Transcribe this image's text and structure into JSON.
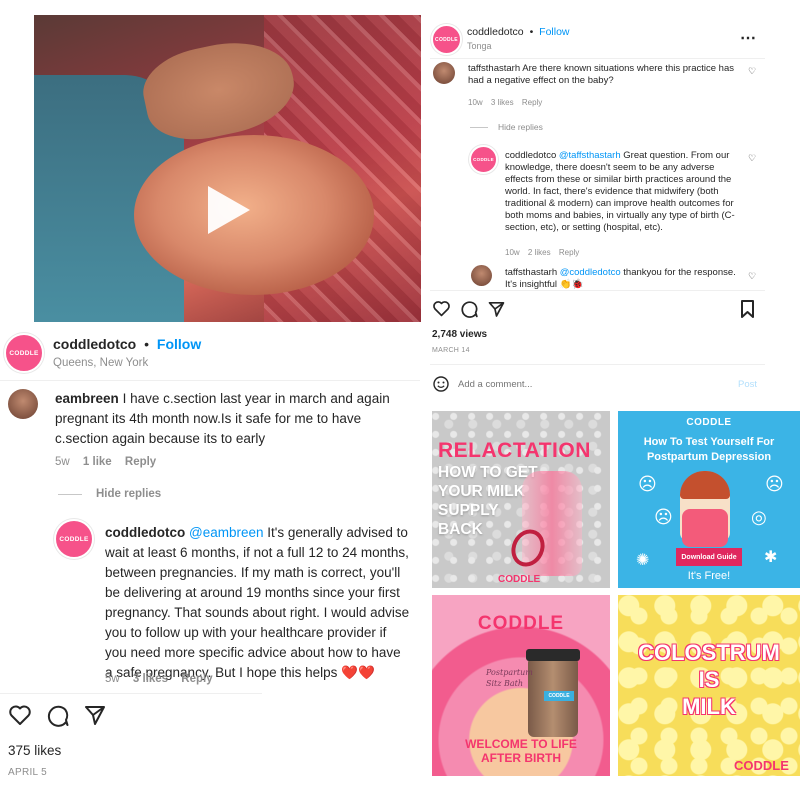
{
  "left_post": {
    "username": "coddledotco",
    "separator": "•",
    "follow_label": "Follow",
    "location": "Queens, New York",
    "avatar_text": "CODDLE",
    "comment": {
      "username": "eambreen",
      "text": "I have c.section last year in march and again pregnant its 4th month now.Is it safe for me to have c.section again because its to early",
      "age": "5w",
      "likes": "1 like",
      "reply_label": "Reply"
    },
    "hide_replies_label": "Hide replies",
    "reply": {
      "username": "coddledotco",
      "mention": "@eambreen",
      "text": "It's generally advised to wait at least 6 months, if not a full 12 to 24 months, between pregnancies. If my math is correct, you'll be delivering at around 19 months since your first pregnancy. That sounds about right. I would advise you to follow up with your healthcare provider if you need more specific advice about how to have a safe pregnancy. But I hope this helps",
      "emoji": "❤️❤️",
      "age": "5w",
      "likes": "3 likes",
      "reply_label": "Reply"
    },
    "like_count": "375 likes",
    "date": "APRIL 5"
  },
  "right_post": {
    "username": "coddledotco",
    "separator": "•",
    "follow_label": "Follow",
    "location": "Tonga",
    "avatar_text": "CODDLE",
    "more_icon": "⋯",
    "comment1": {
      "username": "taffsthastarh",
      "text": "Are there known situations where this practice has had a negative effect on the baby?",
      "age": "10w",
      "likes": "3 likes",
      "reply_label": "Reply"
    },
    "hide_replies_label": "Hide replies",
    "reply1": {
      "username": "coddledotco",
      "mention": "@taffsthastarh",
      "text": "Great question. From our knowledge, there doesn't seem to be any adverse effects from these or similar birth practices around the world. In fact, there's evidence that midwifery (both traditional & modern) can improve health outcomes for both moms and babies, in virtually any type of birth (C-section, etc), or setting (hospital, etc).",
      "age": "10w",
      "likes": "2 likes",
      "reply_label": "Reply"
    },
    "reply2": {
      "username": "taffsthastarh",
      "mention": "@coddledotco",
      "text": "thankyou for the response. It's insightful",
      "emoji": "👏🐞"
    },
    "views": "2,748 views",
    "date": "MARCH 14",
    "add_comment_placeholder": "Add a comment...",
    "post_label": "Post"
  },
  "tiles": {
    "t1": {
      "line1": "RELACTATION",
      "line2": "HOW TO GET",
      "line3": "YOUR MILK",
      "line4": "SUPPLY",
      "line5": "BACK",
      "brand": "CODDLE"
    },
    "t2": {
      "brand": "CODDLE",
      "title1": "How To Test Yourself For",
      "title2": "Postpartum Depression",
      "button": "Download Guide",
      "footer": "It's Free!"
    },
    "t3": {
      "brand": "CODDLE",
      "jar_line1": "Postpartum",
      "jar_line2": "Sitz Bath",
      "jar_label": "CODDLE",
      "footer1": "WELCOME TO LIFE",
      "footer2": "AFTER BIRTH"
    },
    "t4": {
      "line1": "COLOSTRUM",
      "line2": "IS",
      "line3": "MILK",
      "brand": "CODDLE"
    }
  },
  "colors": {
    "brand_pink": "#f6528a",
    "link_blue": "#0095f6",
    "heart_red": "#e0245e"
  }
}
